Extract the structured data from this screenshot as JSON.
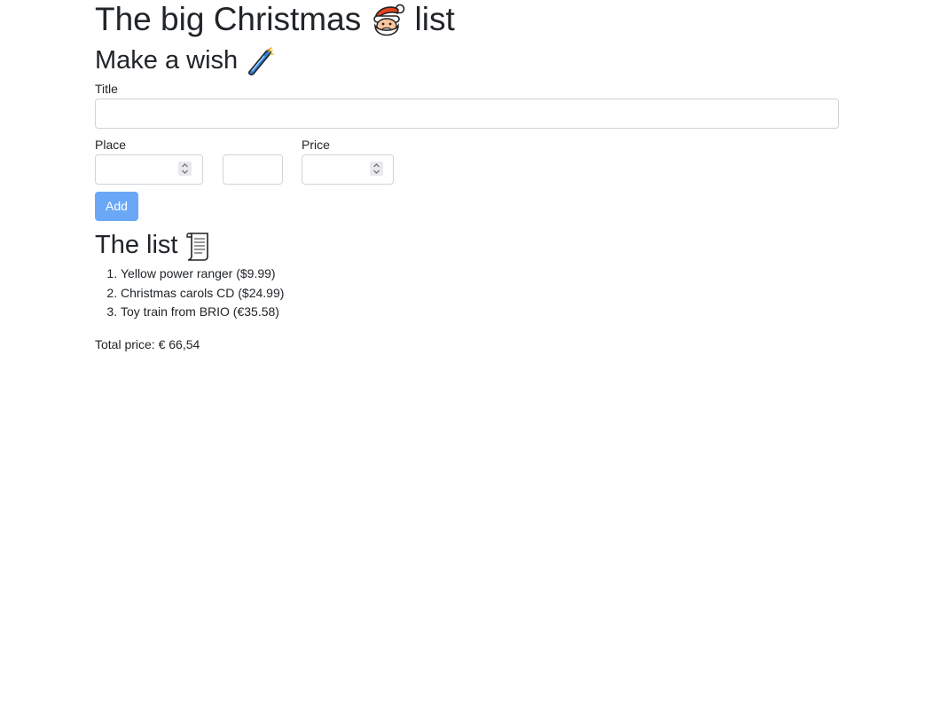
{
  "header": {
    "title_pre": "The big Christmas",
    "title_emoji": "santa-emoji",
    "title_post": "list"
  },
  "form": {
    "heading": "Make a wish",
    "heading_emoji": "shooting-star-emoji",
    "title_label": "Title",
    "title_value": "",
    "place_label": "Place",
    "place_value": "",
    "extra_value": "",
    "price_label": "Price",
    "price_value": "",
    "add_label": "Add"
  },
  "list": {
    "heading": "The list",
    "heading_emoji": "scroll-emoji",
    "items": [
      {
        "text": "Yellow power ranger ($9.99)"
      },
      {
        "text": "Christmas carols CD ($24.99)"
      },
      {
        "text": "Toy train from BRIO (€35.58)"
      }
    ],
    "total": "Total price: € 66,54"
  },
  "colors": {
    "text": "#212529",
    "button_bg": "#6aa8f7",
    "input_border": "#ced4da"
  }
}
